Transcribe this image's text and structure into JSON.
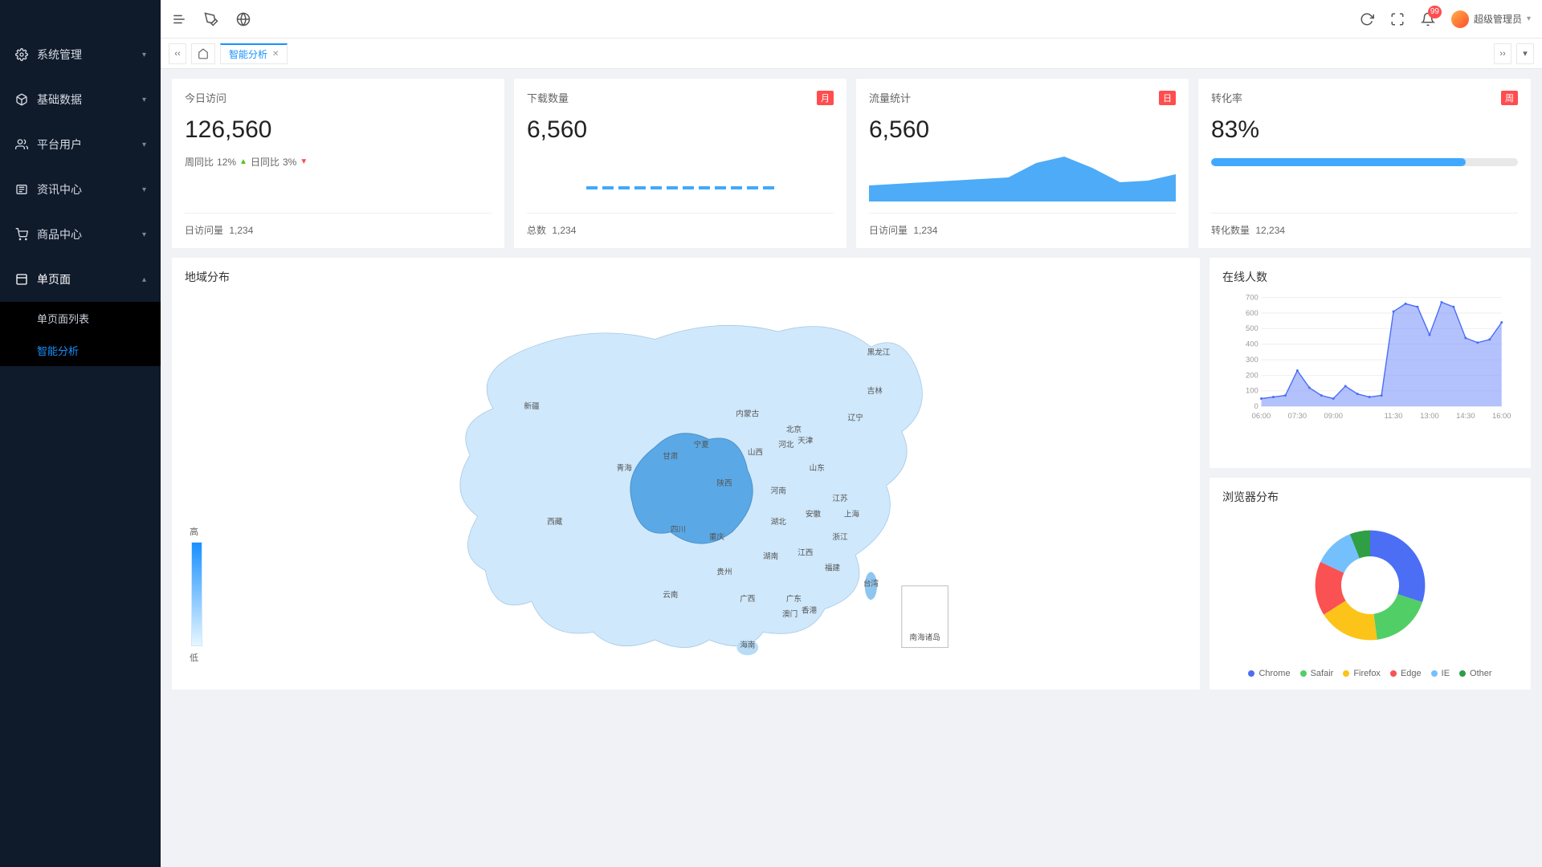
{
  "sidebar": {
    "items": [
      {
        "label": "系统管理",
        "icon": "gear-icon"
      },
      {
        "label": "基础数据",
        "icon": "cube-icon"
      },
      {
        "label": "平台用户",
        "icon": "users-icon"
      },
      {
        "label": "资讯中心",
        "icon": "news-icon"
      },
      {
        "label": "商品中心",
        "icon": "cart-icon"
      },
      {
        "label": "单页面",
        "icon": "page-icon",
        "expanded": true,
        "children": [
          {
            "label": "单页面列表",
            "selected": false
          },
          {
            "label": "智能分析",
            "selected": true
          }
        ]
      }
    ]
  },
  "header": {
    "badge_count": "99",
    "user_name": "超级管理员"
  },
  "tabs": {
    "active_label": "智能分析"
  },
  "stats": {
    "visits": {
      "title": "今日访问",
      "value": "126,560",
      "wow_label": "周同比",
      "wow_value": "12%",
      "dod_label": "日同比",
      "dod_value": "3%",
      "footer_label": "日访问量",
      "footer_value": "1,234"
    },
    "downloads": {
      "title": "下载数量",
      "tag": "月",
      "value": "6,560",
      "footer_label": "总数",
      "footer_value": "1,234"
    },
    "traffic": {
      "title": "流量统计",
      "tag": "日",
      "value": "6,560",
      "footer_label": "日访问量",
      "footer_value": "1,234"
    },
    "conversion": {
      "title": "转化率",
      "tag": "周",
      "value": "83%",
      "progress_percent": 83,
      "footer_label": "转化数量",
      "footer_value": "12,234"
    }
  },
  "map": {
    "title": "地域分布",
    "legend_high": "高",
    "legend_low": "低",
    "provinces": [
      "黑龙江",
      "吉林",
      "辽宁",
      "内蒙古",
      "新疆",
      "西藏",
      "青海",
      "甘肃",
      "宁夏",
      "陕西",
      "山西",
      "河北",
      "北京",
      "天津",
      "山东",
      "河南",
      "江苏",
      "安徽",
      "上海",
      "浙江",
      "湖北",
      "湖南",
      "江西",
      "福建",
      "台湾",
      "广东",
      "广西",
      "香港",
      "澳门",
      "海南",
      "四川",
      "重庆",
      "贵州",
      "云南",
      "南海诸岛"
    ]
  },
  "online": {
    "title": "在线人数"
  },
  "browser": {
    "title": "浏览器分布",
    "items": [
      {
        "name": "Chrome",
        "color": "#4c6ef5"
      },
      {
        "name": "Safair",
        "color": "#51cf66"
      },
      {
        "name": "Firefox",
        "color": "#fcc419"
      },
      {
        "name": "Edge",
        "color": "#fa5252"
      },
      {
        "name": "IE",
        "color": "#74c0fc"
      },
      {
        "name": "Other",
        "color": "#2f9e44"
      }
    ]
  },
  "chart_data": {
    "stat_downloads_spark": {
      "type": "bar",
      "values": [
        1,
        1,
        1,
        1,
        1,
        1,
        1,
        1,
        1,
        1,
        1,
        1
      ],
      "note": "dashed flat segments; visual only, no y-axis"
    },
    "stat_traffic_area": {
      "type": "area",
      "x": [
        0,
        1,
        2,
        3,
        4,
        5,
        6,
        7,
        8,
        9,
        10,
        11
      ],
      "values": [
        20,
        22,
        24,
        26,
        28,
        30,
        48,
        56,
        42,
        24,
        26,
        34
      ],
      "ylim": [
        0,
        60
      ]
    },
    "online_line": {
      "type": "area",
      "x_labels": [
        "06:00",
        "07:30",
        "09:00",
        "11:30",
        "13:00",
        "14:30",
        "16:00"
      ],
      "x": [
        6.0,
        6.5,
        7.0,
        7.5,
        8.0,
        8.5,
        9.0,
        9.5,
        10.0,
        10.5,
        11.0,
        11.5,
        12.0,
        12.5,
        13.0,
        13.5,
        14.0,
        14.5,
        15.0,
        15.5,
        16.0
      ],
      "values": [
        50,
        60,
        70,
        230,
        120,
        70,
        50,
        130,
        80,
        60,
        70,
        610,
        660,
        640,
        460,
        670,
        640,
        440,
        410,
        430,
        540
      ],
      "ylim": [
        0,
        700
      ],
      "y_ticks": [
        0,
        100,
        200,
        300,
        400,
        500,
        600,
        700
      ],
      "title": "在线人数"
    },
    "browser_donut": {
      "type": "pie",
      "series": [
        {
          "name": "Chrome",
          "value": 30,
          "color": "#4c6ef5"
        },
        {
          "name": "Safair",
          "value": 18,
          "color": "#51cf66"
        },
        {
          "name": "Firefox",
          "value": 18,
          "color": "#fcc419"
        },
        {
          "name": "Edge",
          "value": 16,
          "color": "#fa5252"
        },
        {
          "name": "IE",
          "value": 12,
          "color": "#74c0fc"
        },
        {
          "name": "Other",
          "value": 6,
          "color": "#2f9e44"
        }
      ],
      "title": "浏览器分布"
    },
    "map_choropleth": {
      "type": "heatmap",
      "title": "地域分布",
      "scale": "高→低",
      "note": "qualitative blue shading; exact per-province values not labeled in source"
    }
  }
}
